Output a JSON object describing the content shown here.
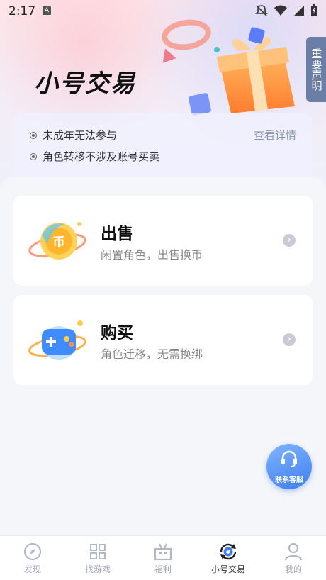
{
  "status_bar": {
    "time": "2:17",
    "a_badge": "A"
  },
  "hero": {
    "title": "小号交易",
    "side_tag": "重要声明"
  },
  "notice": {
    "items": [
      "未成年无法参与",
      "角色转移不涉及账号买卖"
    ],
    "detail_link": "查看详情"
  },
  "cards": [
    {
      "title": "出售",
      "subtitle": "闲置角色，出售换币",
      "icon_char": "币"
    },
    {
      "title": "购买",
      "subtitle": "角色迁移，无需换绑"
    }
  ],
  "fab": {
    "label": "联系客服"
  },
  "tabbar": {
    "active_index": 3,
    "items": [
      {
        "label": "发现",
        "icon": "compass-icon"
      },
      {
        "label": "找游戏",
        "icon": "grid-icon"
      },
      {
        "label": "福利",
        "icon": "gift-box-icon"
      },
      {
        "label": "小号交易",
        "icon": "trade-icon"
      },
      {
        "label": "我的",
        "icon": "profile-icon"
      }
    ]
  },
  "colors": {
    "accent": "#3f7fef",
    "tab_inactive": "#a6abb8",
    "tab_active": "#333333",
    "side_tag": "#6b7fa6"
  }
}
